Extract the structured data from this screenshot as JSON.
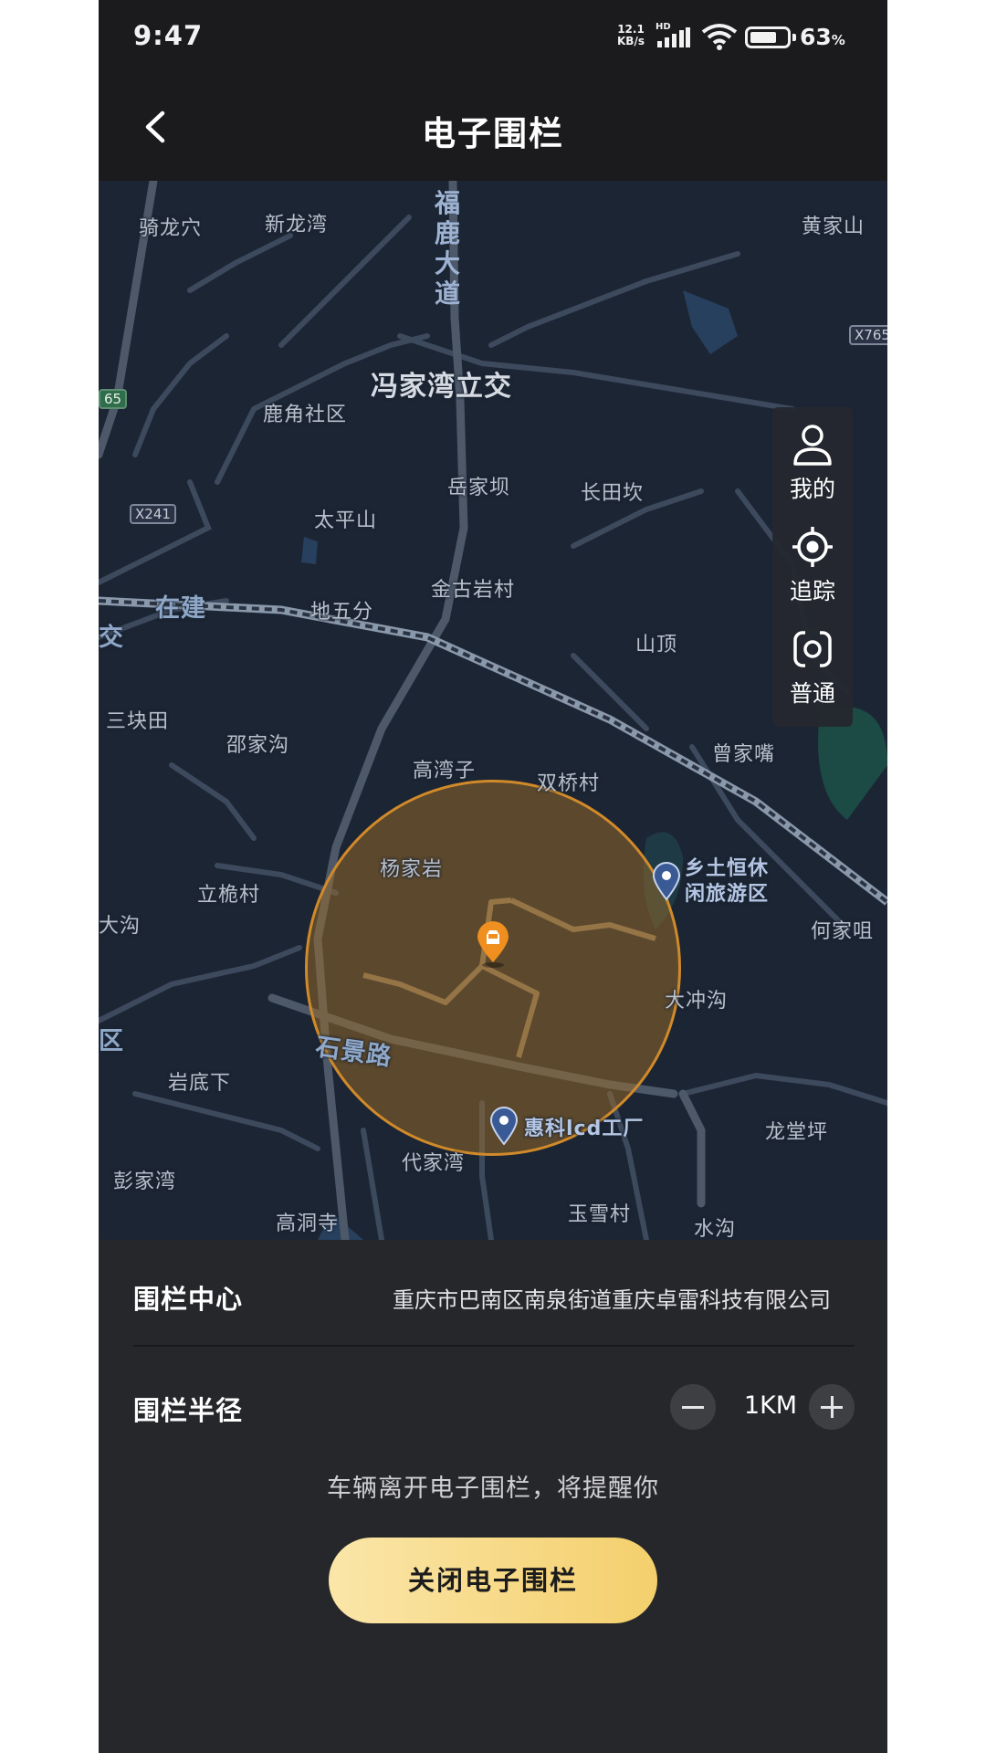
{
  "status_bar": {
    "time": "9:47",
    "speed_value": "12.1",
    "speed_unit": "KB/s",
    "network_badge": "HD",
    "wifi_badge": "6",
    "battery_percent": "63",
    "battery_unit": "%",
    "battery_level": 0.63
  },
  "header": {
    "title": "电子围栏",
    "back_icon": "chevron-left-icon"
  },
  "map": {
    "places": {
      "qilongxue": "骑龙穴",
      "xinlongwan": "新龙湾",
      "luhexiang_road": "福鹿大道",
      "fengjiawan": "冯家湾立交",
      "lujiao": "鹿角社区",
      "yuejiaba": "岳家坝",
      "changtiankan": "长田坎",
      "taipingshan": "太平山",
      "jinguyan": "金古岩村",
      "diwufen": "地五分",
      "zaijian": "在建",
      "jiao": "交",
      "shanding": "山顶",
      "sankuaitian": "三块田",
      "shaojiagou": "邵家沟",
      "gaowanzi": "高湾子",
      "shuangqiao": "双桥村",
      "zengjiazui": "曾家嘴",
      "yangjiayan": "杨家岩",
      "liqiangcun": "立桅村",
      "dagou": "大沟",
      "hejiaju": "何家咀",
      "dachonggou": "大冲沟",
      "shijing_road": "石景路",
      "qu": "区",
      "yandixia": "岩底下",
      "longtangping": "龙堂坪",
      "daijiawan": "代家湾",
      "pengjiawan": "彭家湾",
      "gaodongsi": "高洞寺",
      "yuxuecun": "玉雪村",
      "shuigou": "水沟",
      "huangjiashan": "黄家山",
      "xiangtu_poi": "乡土恒休\n闲旅游区",
      "huike_poi": "惠科lcd工厂"
    },
    "badges": {
      "x241": "X241",
      "x765": "X765",
      "g65": "65"
    },
    "fence_color": "#d18a2a",
    "tools": [
      {
        "label": "我的",
        "icon": "person-icon"
      },
      {
        "label": "追踪",
        "icon": "locate-icon"
      },
      {
        "label": "普通",
        "icon": "map-layer-icon"
      }
    ]
  },
  "panel": {
    "center_label": "围栏中心",
    "center_value": "重庆市巴南区南泉街道重庆卓雷科技有限公司",
    "radius_label": "围栏半径",
    "radius_value": "1KM",
    "hint": "车辆离开电子围栏，将提醒你",
    "close_button": "关闭电子围栏",
    "accent_gradient": [
      "#fbe6a9",
      "#f4cf6c"
    ]
  }
}
